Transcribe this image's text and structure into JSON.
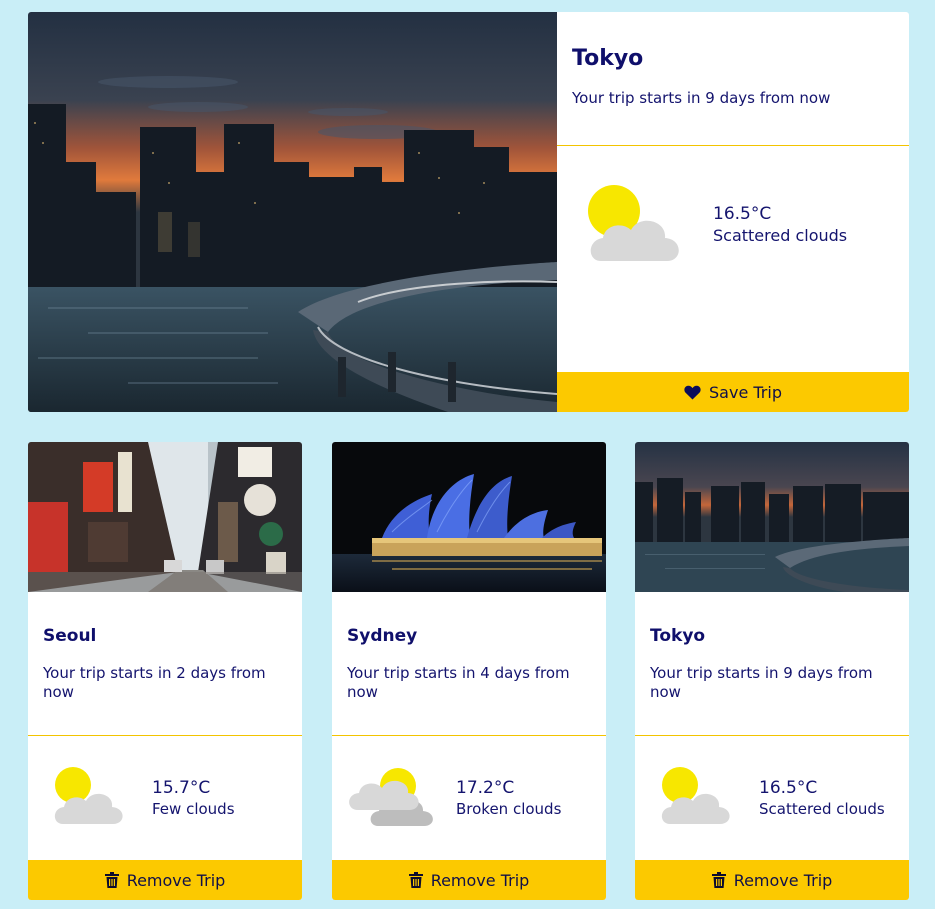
{
  "featured": {
    "city": "Tokyo",
    "countdown": "Your trip starts in 9 days from now",
    "temperature": "16.5°C",
    "condition": "Scattered clouds",
    "weather_icon": "sun-behind-cloud-icon",
    "photo": "tokyo-skyline-photo",
    "action_label": "Save Trip",
    "action_icon": "heart-icon"
  },
  "trips": [
    {
      "city": "Seoul",
      "countdown": "Your trip starts in 2 days from now",
      "temperature": "15.7°C",
      "condition": "Few clouds",
      "weather_icon": "sun-behind-cloud-icon",
      "photo": "seoul-street-photo",
      "action_label": "Remove Trip",
      "action_icon": "trash-icon"
    },
    {
      "city": "Sydney",
      "countdown": "Your trip starts in 4 days from now",
      "temperature": "17.2°C",
      "condition": "Broken clouds",
      "weather_icon": "broken-clouds-icon",
      "photo": "sydney-opera-house-photo",
      "action_label": "Remove Trip",
      "action_icon": "trash-icon"
    },
    {
      "city": "Tokyo",
      "countdown": "Your trip starts in 9 days from now",
      "temperature": "16.5°C",
      "condition": "Scattered clouds",
      "weather_icon": "sun-behind-cloud-icon",
      "photo": "tokyo-skyline-photo",
      "action_label": "Remove Trip",
      "action_icon": "trash-icon"
    }
  ],
  "colors": {
    "background": "#c9eef7",
    "accent": "#fcc900",
    "text": "#14146e",
    "sun": "#f7e700",
    "cloud": "#d8d8d8"
  }
}
